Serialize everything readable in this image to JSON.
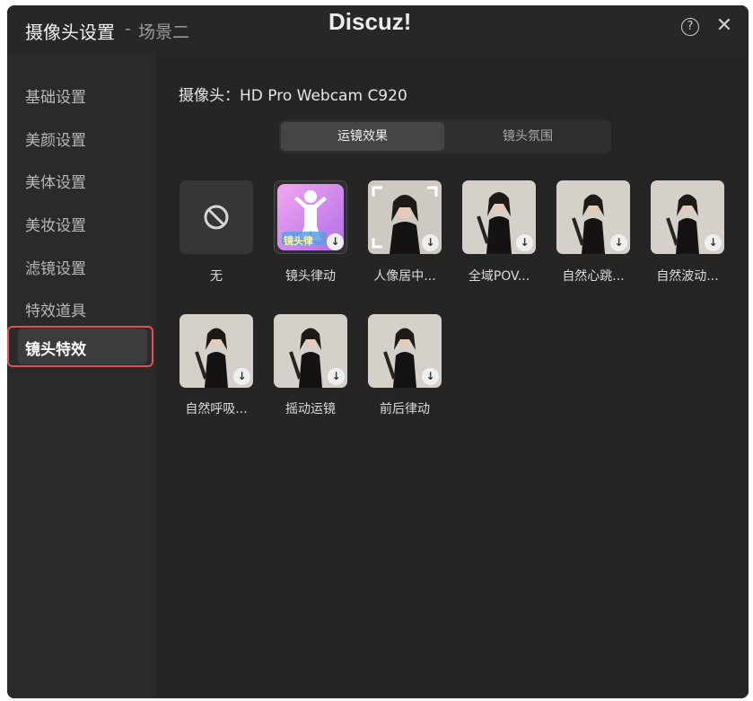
{
  "window": {
    "title": "摄像头设置",
    "title_separator": "-",
    "subtitle": "场景二",
    "watermark": "Discuz!",
    "help_glyph": "?",
    "close_glyph": "✕"
  },
  "sidebar": {
    "items": [
      {
        "label": "基础设置",
        "active": false
      },
      {
        "label": "美颜设置",
        "active": false
      },
      {
        "label": "美体设置",
        "active": false
      },
      {
        "label": "美妆设置",
        "active": false
      },
      {
        "label": "滤镜设置",
        "active": false
      },
      {
        "label": "特效道具",
        "active": false
      },
      {
        "label": "镜头特效",
        "active": true
      }
    ]
  },
  "main": {
    "camera_label": "摄像头：HD Pro Webcam C920",
    "tabs": [
      {
        "label": "运镜效果",
        "active": true
      },
      {
        "label": "镜头氛围",
        "active": false
      }
    ],
    "effects": [
      {
        "label": "无",
        "thumb": "none-icon",
        "download": false
      },
      {
        "label": "镜头律动",
        "thumb": "cartoon-thumbnail",
        "thumb_text": "镜头律",
        "download": true
      },
      {
        "label": "人像居中...",
        "thumb": "portrait-frame-thumbnail",
        "download": true
      },
      {
        "label": "全域POV...",
        "thumb": "portrait-thumbnail",
        "download": true
      },
      {
        "label": "自然心跳...",
        "thumb": "portrait-thumbnail",
        "download": true
      },
      {
        "label": "自然波动...",
        "thumb": "portrait-thumbnail",
        "download": true
      },
      {
        "label": "自然呼吸...",
        "thumb": "portrait-thumbnail",
        "download": true
      },
      {
        "label": "摇动运镜",
        "thumb": "portrait-thumbnail",
        "download": true
      },
      {
        "label": "前后律动",
        "thumb": "portrait-thumbnail",
        "download": true
      }
    ],
    "download_glyph": "↓"
  },
  "colors": {
    "window_bg": "#252525",
    "sidebar_bg": "#2a2a2a",
    "highlight_border": "#e0524f",
    "tab_active_bg": "#454545"
  }
}
